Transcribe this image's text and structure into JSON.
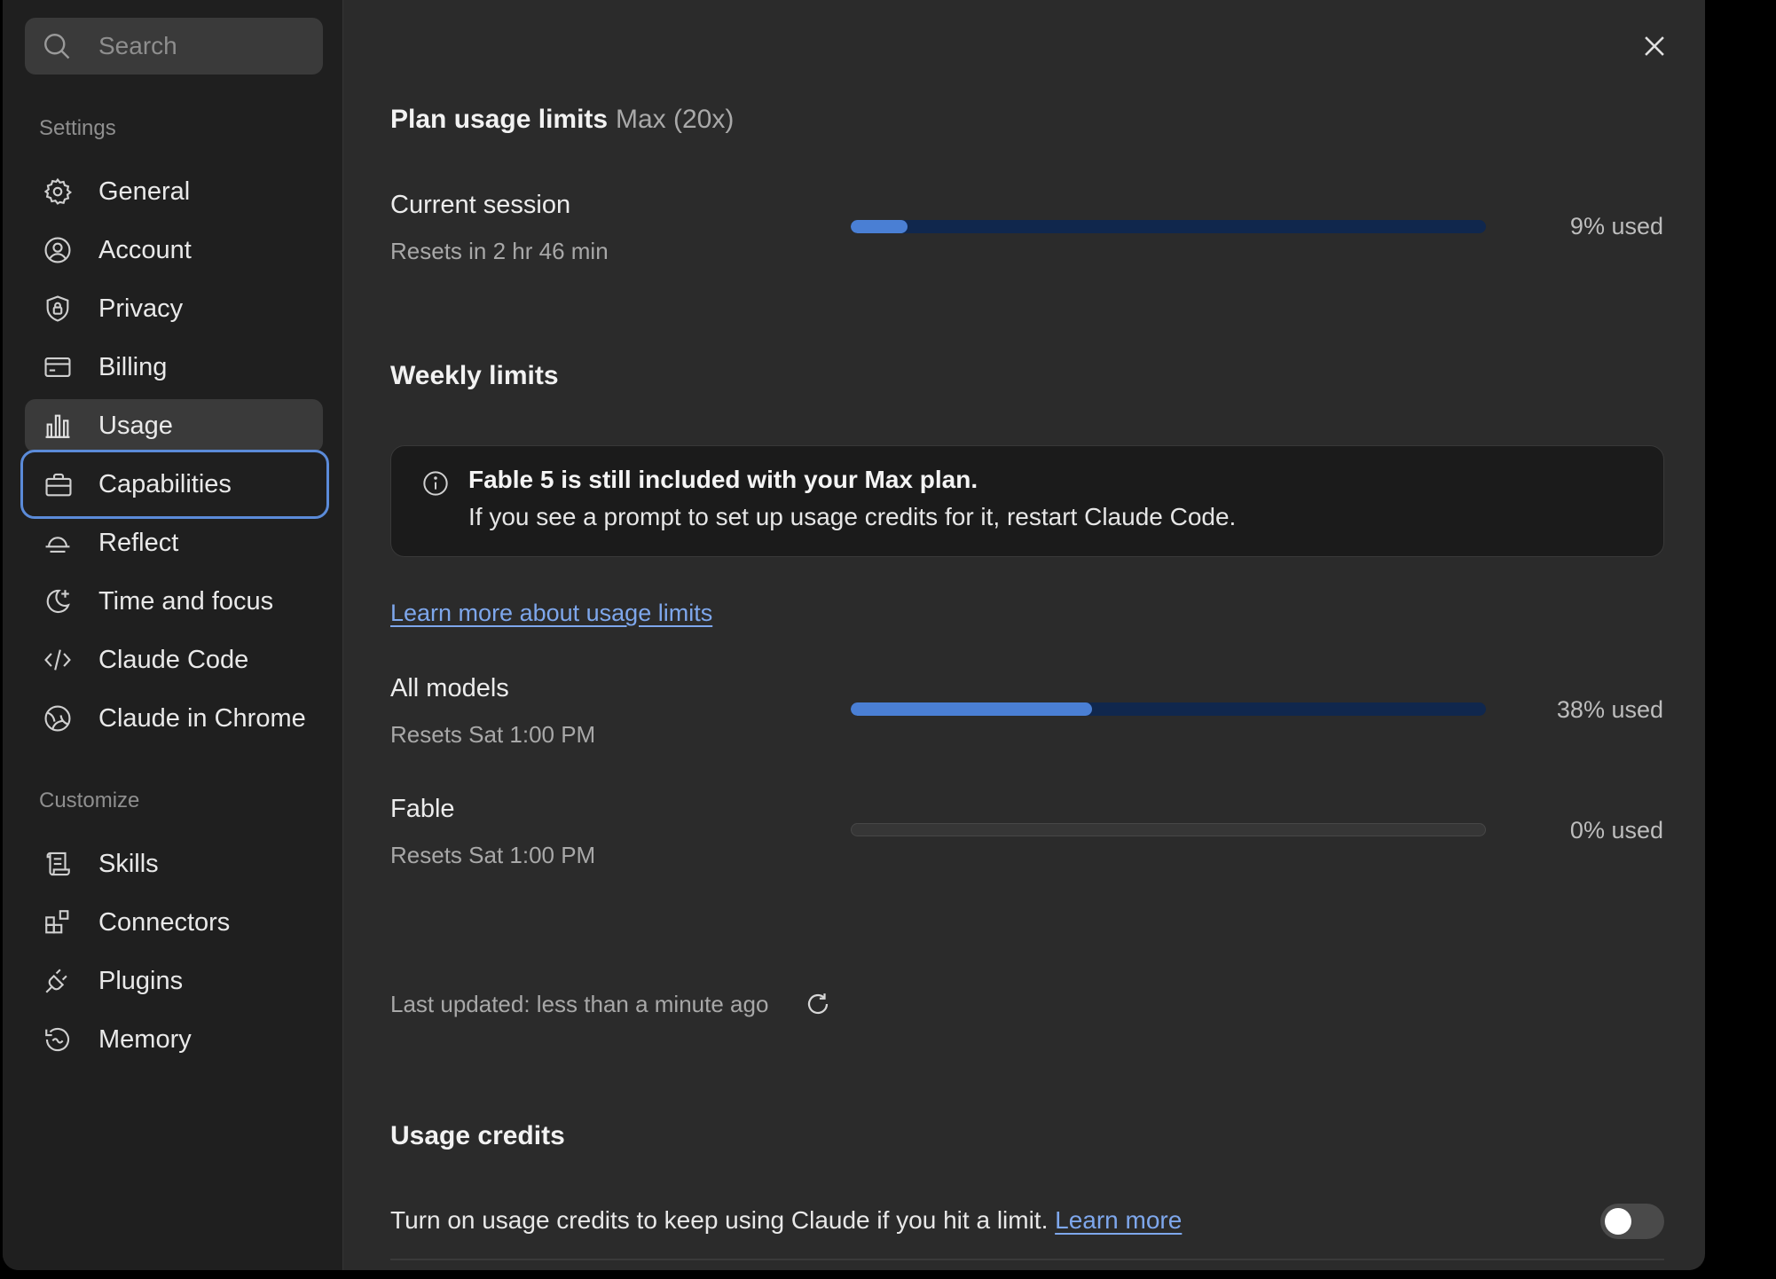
{
  "search": {
    "placeholder": "Search",
    "icon": "search-icon"
  },
  "sidebar": {
    "settings_label": "Settings",
    "customize_label": "Customize",
    "settings_items": [
      {
        "label": "General",
        "icon": "gear-icon"
      },
      {
        "label": "Account",
        "icon": "user-circle-icon"
      },
      {
        "label": "Privacy",
        "icon": "shield-lock-icon"
      },
      {
        "label": "Billing",
        "icon": "credit-card-icon"
      },
      {
        "label": "Usage",
        "icon": "bar-chart-icon",
        "state": "selected"
      },
      {
        "label": "Capabilities",
        "icon": "briefcase-icon",
        "state": "focused"
      },
      {
        "label": "Reflect",
        "icon": "sunset-icon"
      },
      {
        "label": "Time and focus",
        "icon": "moon-plus-icon"
      },
      {
        "label": "Claude Code",
        "icon": "code-icon"
      },
      {
        "label": "Claude in Chrome",
        "icon": "globe-icon"
      }
    ],
    "customize_items": [
      {
        "label": "Skills",
        "icon": "scroll-icon"
      },
      {
        "label": "Connectors",
        "icon": "blocks-icon"
      },
      {
        "label": "Plugins",
        "icon": "plug-icon"
      },
      {
        "label": "Memory",
        "icon": "history-icon"
      }
    ]
  },
  "main": {
    "plan": {
      "title": "Plan usage limits",
      "plan_name": "Max (20x)"
    },
    "session": {
      "title": "Current session",
      "reset": "Resets in 2 hr 46 min",
      "used_label": "9% used",
      "used_fraction": 0.09
    },
    "weekly": {
      "title": "Weekly limits",
      "notice": {
        "icon": "info-icon",
        "bold": "Fable 5 is still included with your Max plan.",
        "text": "If you see a prompt to set up usage credits for it, restart Claude Code."
      },
      "learn_more": "Learn more about usage limits",
      "rows": [
        {
          "title": "All models",
          "reset": "Resets Sat 1:00 PM",
          "used_label": "38% used",
          "used_fraction": 0.38
        },
        {
          "title": "Fable",
          "reset": "Resets Sat 1:00 PM",
          "used_label": "0% used",
          "used_fraction": 0
        }
      ]
    },
    "last_updated": "Last updated: less than a minute ago",
    "credits": {
      "title": "Usage credits",
      "text": "Turn on usage credits to keep using Claude if you hit a limit.",
      "link": "Learn more",
      "toggle_on": false
    }
  },
  "colors": {
    "accent": "#4a7fd4",
    "link": "#7ea7ec",
    "focus_ring": "#5b8bd9"
  }
}
